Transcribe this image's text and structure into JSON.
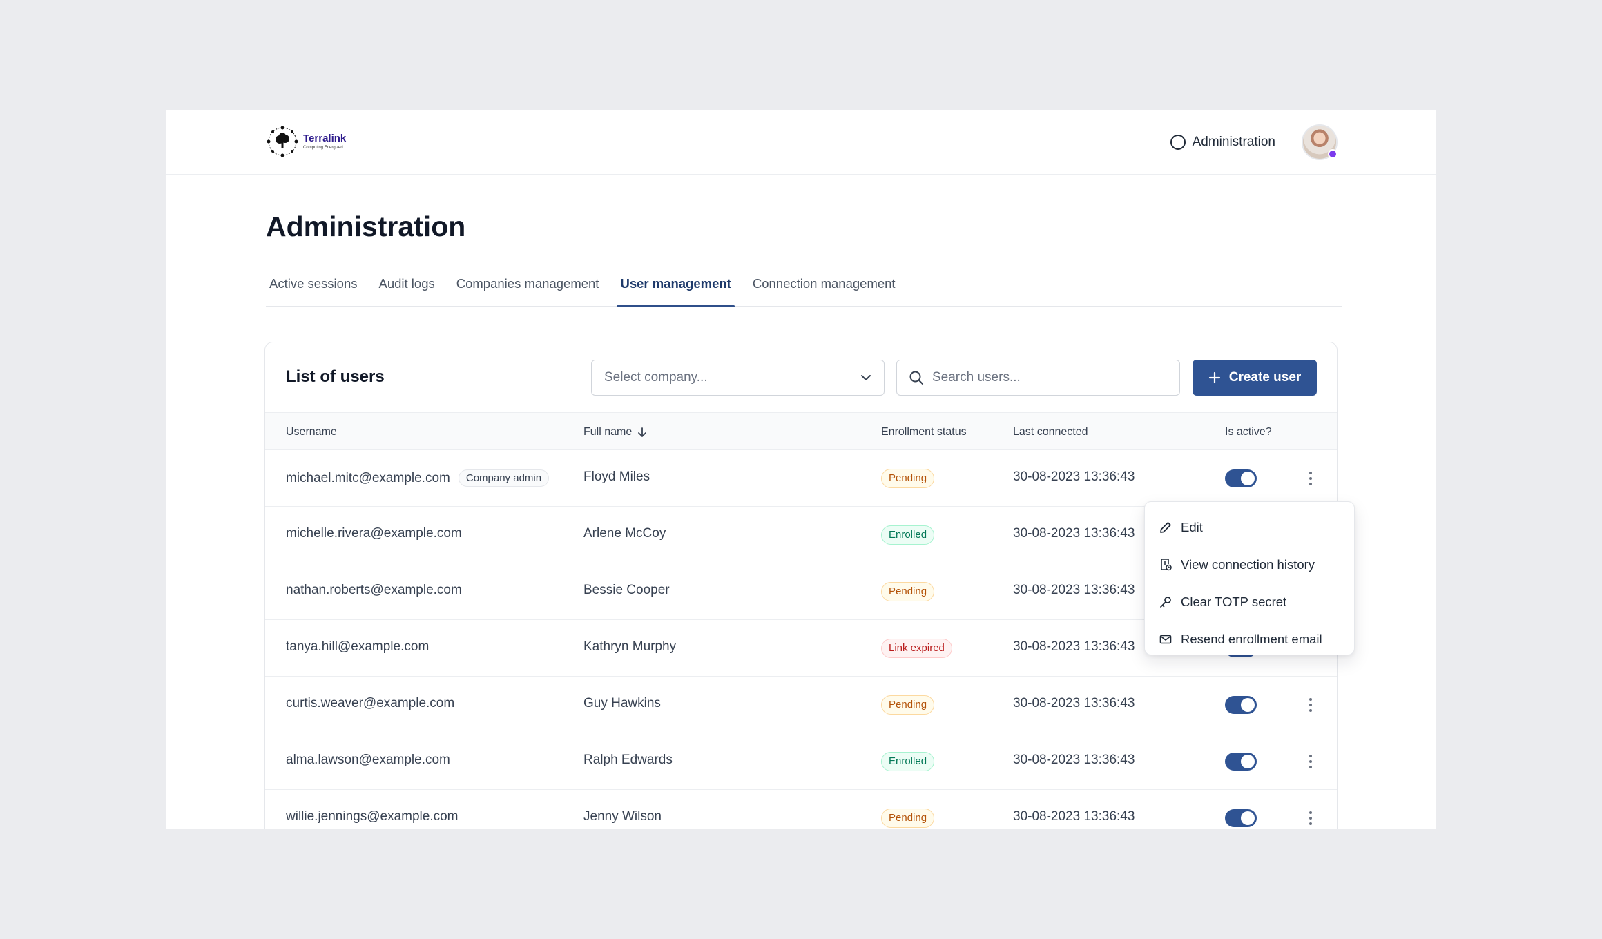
{
  "brand": {
    "name": "Terralink",
    "tagline": "Computing Energized"
  },
  "header": {
    "admin_link": "Administration"
  },
  "page": {
    "title": "Administration"
  },
  "tabs": [
    {
      "label": "Active sessions",
      "active": false
    },
    {
      "label": "Audit logs",
      "active": false
    },
    {
      "label": "Companies management",
      "active": false
    },
    {
      "label": "User management",
      "active": true
    },
    {
      "label": "Connection management",
      "active": false
    }
  ],
  "card": {
    "title": "List of users",
    "company_select": {
      "placeholder": "Select company..."
    },
    "search": {
      "placeholder": "Search users..."
    },
    "create_label": "Create user"
  },
  "table": {
    "columns": {
      "username": "Username",
      "full_name": "Full name",
      "enrollment": "Enrollment status",
      "last_connected": "Last connected",
      "is_active": "Is active?"
    },
    "rows": [
      {
        "username": "michael.mitc@example.com",
        "role": "Company admin",
        "full_name": "Floyd Miles",
        "status": "Pending",
        "last_connected": "30-08-2023 13:36:43",
        "active": true
      },
      {
        "username": "michelle.rivera@example.com",
        "role": "",
        "full_name": "Arlene McCoy",
        "status": "Enrolled",
        "last_connected": "30-08-2023 13:36:43",
        "active": true
      },
      {
        "username": "nathan.roberts@example.com",
        "role": "",
        "full_name": "Bessie Cooper",
        "status": "Pending",
        "last_connected": "30-08-2023 13:36:43",
        "active": true
      },
      {
        "username": "tanya.hill@example.com",
        "role": "",
        "full_name": "Kathryn Murphy",
        "status": "Link expired",
        "last_connected": "30-08-2023 13:36:43",
        "active": true
      },
      {
        "username": "curtis.weaver@example.com",
        "role": "",
        "full_name": "Guy Hawkins",
        "status": "Pending",
        "last_connected": "30-08-2023 13:36:43",
        "active": true
      },
      {
        "username": "alma.lawson@example.com",
        "role": "",
        "full_name": "Ralph Edwards",
        "status": "Enrolled",
        "last_connected": "30-08-2023 13:36:43",
        "active": true
      },
      {
        "username": "willie.jennings@example.com",
        "role": "",
        "full_name": "Jenny Wilson",
        "status": "Pending",
        "last_connected": "30-08-2023 13:36:43",
        "active": true
      }
    ]
  },
  "menu": {
    "items": [
      {
        "label": "Edit",
        "icon": "pencil-icon"
      },
      {
        "label": "View connection history",
        "icon": "history-icon"
      },
      {
        "label": "Clear TOTP secret",
        "icon": "key-icon"
      },
      {
        "label": "Resend enrollment email",
        "icon": "mail-icon"
      }
    ]
  },
  "colors": {
    "primary": "#2f5393",
    "pending": "#b45309",
    "enrolled": "#047857",
    "expired": "#b91c1c"
  }
}
